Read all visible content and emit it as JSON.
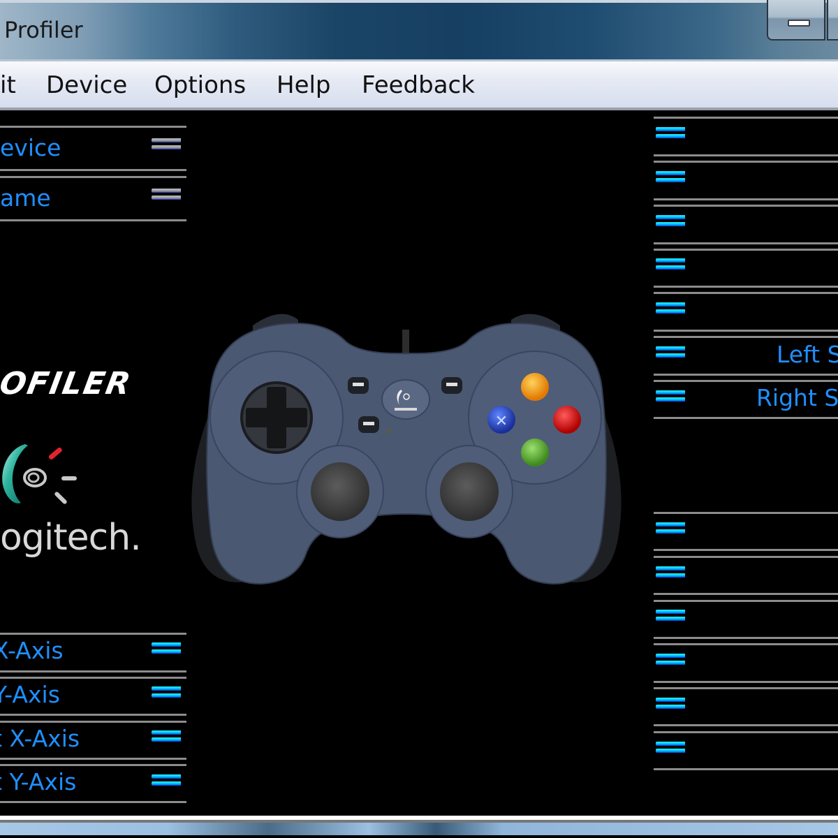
{
  "window": {
    "title": "Profiler",
    "controls": [
      "minimize-button",
      "maximize-button"
    ]
  },
  "menubar": {
    "items": [
      {
        "label": "it"
      },
      {
        "label": "Device"
      },
      {
        "label": "Options"
      },
      {
        "label": "Help"
      },
      {
        "label": "Feedback"
      }
    ]
  },
  "left_panel": {
    "top_rows": [
      {
        "label": "evice",
        "icon": "menu-lines-icon-gray"
      },
      {
        "label": "ame",
        "icon": "menu-lines-icon-gray"
      }
    ],
    "branding": {
      "profiler_text": "OFILER",
      "logitech_text": "ogitech."
    },
    "axis_rows": [
      {
        "label": "X-Axis",
        "icon": "menu-lines-icon-blue"
      },
      {
        "label": "Y-Axis",
        "icon": "menu-lines-icon-blue"
      },
      {
        "label": "X-Axis",
        "prefix": "t",
        "icon": "menu-lines-icon-blue"
      },
      {
        "label": "Y-Axis",
        "prefix": "t",
        "icon": "menu-lines-icon-blue"
      }
    ]
  },
  "left_axis_rows_display": [
    "-Axis",
    "-Axis",
    " X-Axis",
    " Y-Axis"
  ],
  "device_image": {
    "name": "Logitech F310 Gamepad",
    "button_colors": {
      "yellow": "#f6a21a",
      "red": "#e21d1d",
      "blue": "#2a4fd0",
      "green": "#55b030"
    },
    "body_color": "#4a5872"
  },
  "right_panel": {
    "rows": [
      {
        "label": ""
      },
      {
        "label": ""
      },
      {
        "label": ""
      },
      {
        "label": ""
      },
      {
        "label": ""
      },
      {
        "label": "Left S"
      },
      {
        "label": "Right S"
      }
    ],
    "lower_rows": [
      {
        "label": ""
      },
      {
        "label": ""
      },
      {
        "label": ""
      },
      {
        "label": ""
      },
      {
        "label": ""
      },
      {
        "label": ""
      }
    ]
  },
  "colors": {
    "label_blue": "#1f8fff",
    "divider_gray": "#8c8c8c",
    "background": "#000000"
  }
}
